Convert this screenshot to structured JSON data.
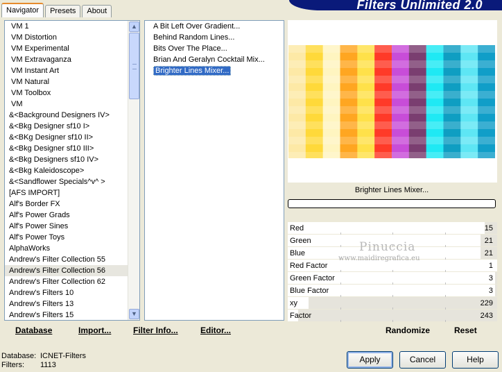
{
  "tabs": [
    {
      "label": "Navigator",
      "active": true
    },
    {
      "label": "Presets",
      "active": false
    },
    {
      "label": "About",
      "active": false
    }
  ],
  "banner": {
    "title": "Filters Unlimited 2.0",
    "color": "#0a1a7a"
  },
  "categories": [
    "VM 1",
    "VM Distortion",
    "VM Experimental",
    "VM Extravaganza",
    "VM Instant Art",
    "VM Natural",
    "VM Toolbox",
    "VM",
    "&<Background Designers IV>",
    "&<Bkg Designer sf10 I>",
    "&<BKg Designer sf10 II>",
    "&<Bkg Designer sf10 III>",
    "&<Bkg Designers sf10 IV>",
    "&<Bkg Kaleidoscope>",
    "&<Sandflower Specials^v^ >",
    "[AFS IMPORT]",
    "Alf's Border FX",
    "Alf's Power Grads",
    "Alf's Power Sines",
    "Alf's Power Toys",
    "AlphaWorks",
    "Andrew's Filter Collection 55",
    "Andrew's Filter Collection 56",
    "Andrew's Filter Collection 62",
    "Andrew's Filters 10",
    "Andrew's Filters 13",
    "Andrew's Filters 15"
  ],
  "selected_category": "Andrew's Filter Collection 56",
  "filters": [
    {
      "label": "A Bit Left Over Gradient...",
      "selected": false
    },
    {
      "label": "Behind Random Lines...",
      "selected": false
    },
    {
      "label": "Bits Over The Place...",
      "selected": false
    },
    {
      "label": "Brian And Geralyn Cocktail Mix...",
      "selected": false
    },
    {
      "label": "Brighter Lines Mixer...",
      "selected": true
    }
  ],
  "preview": {
    "label": "Brighter Lines Mixer...",
    "stripes": [
      "#fde9a6",
      "#ffd93a",
      "#fff5c0",
      "#ffa621",
      "#ffe14a",
      "#ff3a28",
      "#c84dd8",
      "#7a3e70",
      "#1fe9f4",
      "#0f9ec2",
      "#5ee6f4",
      "#109ec8"
    ]
  },
  "params": [
    {
      "name": "Red",
      "value": "15",
      "fraction": 0.06
    },
    {
      "name": "Green",
      "value": "21",
      "fraction": 0.08
    },
    {
      "name": "Blue",
      "value": "21",
      "fraction": 0.08
    },
    {
      "name": "Red Factor",
      "value": "1",
      "fraction": 0.0
    },
    {
      "name": "Green Factor",
      "value": "3",
      "fraction": 0.01
    },
    {
      "name": "Blue Factor",
      "value": "3",
      "fraction": 0.01
    },
    {
      "name": "xy",
      "value": "229",
      "fraction": 0.9
    },
    {
      "name": "Factor",
      "value": "243",
      "fraction": 0.95
    }
  ],
  "watermark": {
    "name": "Pinuccia",
    "url": "www.maidiregrafica.eu"
  },
  "menu": {
    "database": "Database",
    "import": "Import...",
    "filter_info": "Filter Info...",
    "editor": "Editor..."
  },
  "actions": {
    "randomize": "Randomize",
    "reset": "Reset"
  },
  "info": {
    "database_label": "Database:",
    "database_value": "ICNET-Filters",
    "filters_label": "Filters:",
    "filters_value": "1113"
  },
  "buttons": {
    "apply": "Apply",
    "cancel": "Cancel",
    "help": "Help"
  },
  "scroll_icons": {
    "up": "scroll-up-arrow-icon",
    "down": "scroll-down-arrow-icon"
  }
}
